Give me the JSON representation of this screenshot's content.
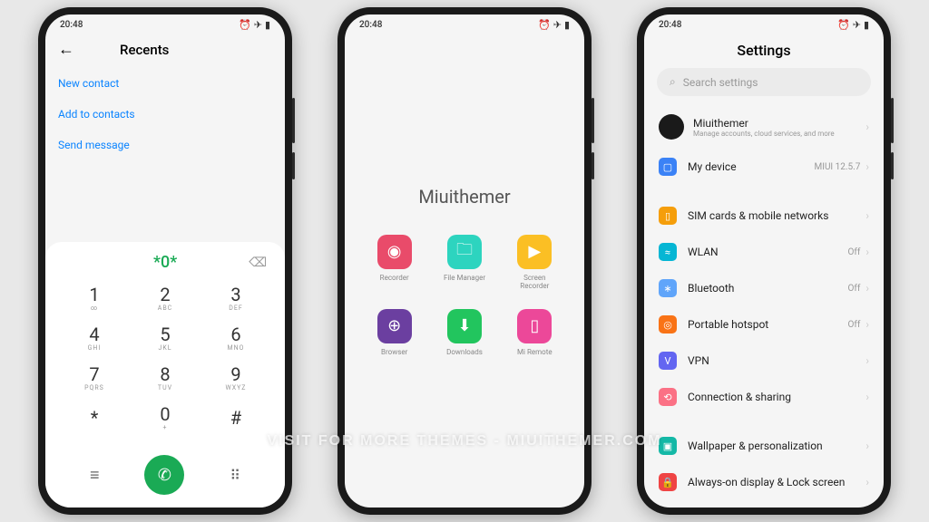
{
  "status": {
    "time": "20:48",
    "alarm": "⏰",
    "plane": "✈",
    "battery": "▮"
  },
  "phone1": {
    "title": "Recents",
    "actions": [
      "New contact",
      "Add to contacts",
      "Send message"
    ],
    "dialed": "*0*",
    "keys": [
      {
        "n": "1",
        "s": "∞"
      },
      {
        "n": "2",
        "s": "ABC"
      },
      {
        "n": "3",
        "s": "DEF"
      },
      {
        "n": "4",
        "s": "GHI"
      },
      {
        "n": "5",
        "s": "JKL"
      },
      {
        "n": "6",
        "s": "MNO"
      },
      {
        "n": "7",
        "s": "PQRS"
      },
      {
        "n": "8",
        "s": "TUV"
      },
      {
        "n": "9",
        "s": "WXYZ"
      },
      {
        "n": "*",
        "s": ""
      },
      {
        "n": "0",
        "s": "+"
      },
      {
        "n": "#",
        "s": ""
      }
    ]
  },
  "phone2": {
    "title": "Miuithemer",
    "apps": [
      {
        "label": "Recorder",
        "cls": "ic-red",
        "glyph": "◉"
      },
      {
        "label": "File Manager",
        "cls": "ic-teal",
        "glyph": "🗀"
      },
      {
        "label": "Screen Recorder",
        "cls": "ic-yellow",
        "glyph": "▶"
      },
      {
        "label": "Browser",
        "cls": "ic-purple",
        "glyph": "⊕"
      },
      {
        "label": "Downloads",
        "cls": "ic-green",
        "glyph": "⬇"
      },
      {
        "label": "Mi Remote",
        "cls": "ic-pink",
        "glyph": "▯"
      }
    ]
  },
  "phone3": {
    "title": "Settings",
    "search": "Search settings",
    "account": {
      "name": "Miuithemer",
      "sub": "Manage accounts, cloud services, and more"
    },
    "device": {
      "name": "My device",
      "val": "MIUI 12.5.7",
      "cls": "si-blue",
      "glyph": "▢"
    },
    "net": [
      {
        "name": "SIM cards & mobile networks",
        "val": "",
        "cls": "si-yellow",
        "glyph": "▯"
      },
      {
        "name": "WLAN",
        "val": "Off",
        "cls": "si-cyan",
        "glyph": "≈"
      },
      {
        "name": "Bluetooth",
        "val": "Off",
        "cls": "si-lblue",
        "glyph": "∗"
      },
      {
        "name": "Portable hotspot",
        "val": "Off",
        "cls": "si-orange",
        "glyph": "◎"
      },
      {
        "name": "VPN",
        "val": "",
        "cls": "si-purple",
        "glyph": "V"
      },
      {
        "name": "Connection & sharing",
        "val": "",
        "cls": "si-coral",
        "glyph": "⟲"
      }
    ],
    "display": [
      {
        "name": "Wallpaper & personalization",
        "val": "",
        "cls": "si-teal2",
        "glyph": "▣"
      },
      {
        "name": "Always-on display & Lock screen",
        "val": "",
        "cls": "si-red",
        "glyph": "🔒"
      }
    ]
  },
  "watermark": "VISIT FOR MORE THEMES - MIUITHEMER.COM"
}
